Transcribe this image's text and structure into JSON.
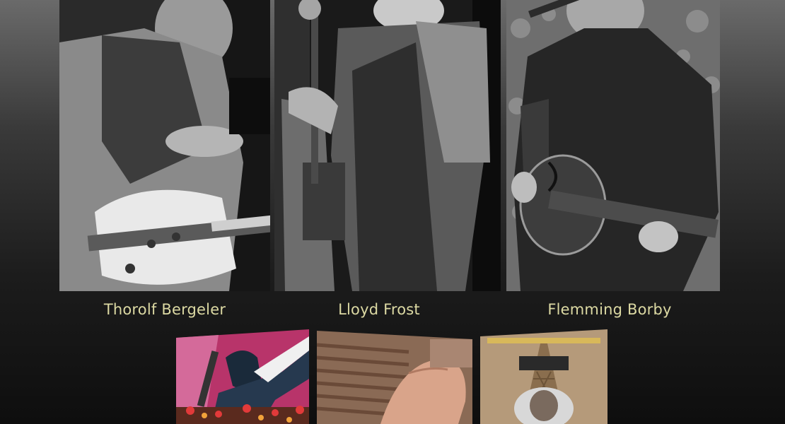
{
  "musicians": [
    {
      "name": "Thorolf Bergeler"
    },
    {
      "name": "Lloyd Frost"
    },
    {
      "name": "Flemming Borby"
    }
  ],
  "covers": [
    {
      "icon": "album-cover-poster-art"
    },
    {
      "icon": "album-cover-hands"
    },
    {
      "icon": "album-cover-eiffel-tower"
    }
  ],
  "colors": {
    "name_text": "#dcd9a3",
    "background_top": "#6a6a6a",
    "background_bottom": "#0e0e0e"
  }
}
